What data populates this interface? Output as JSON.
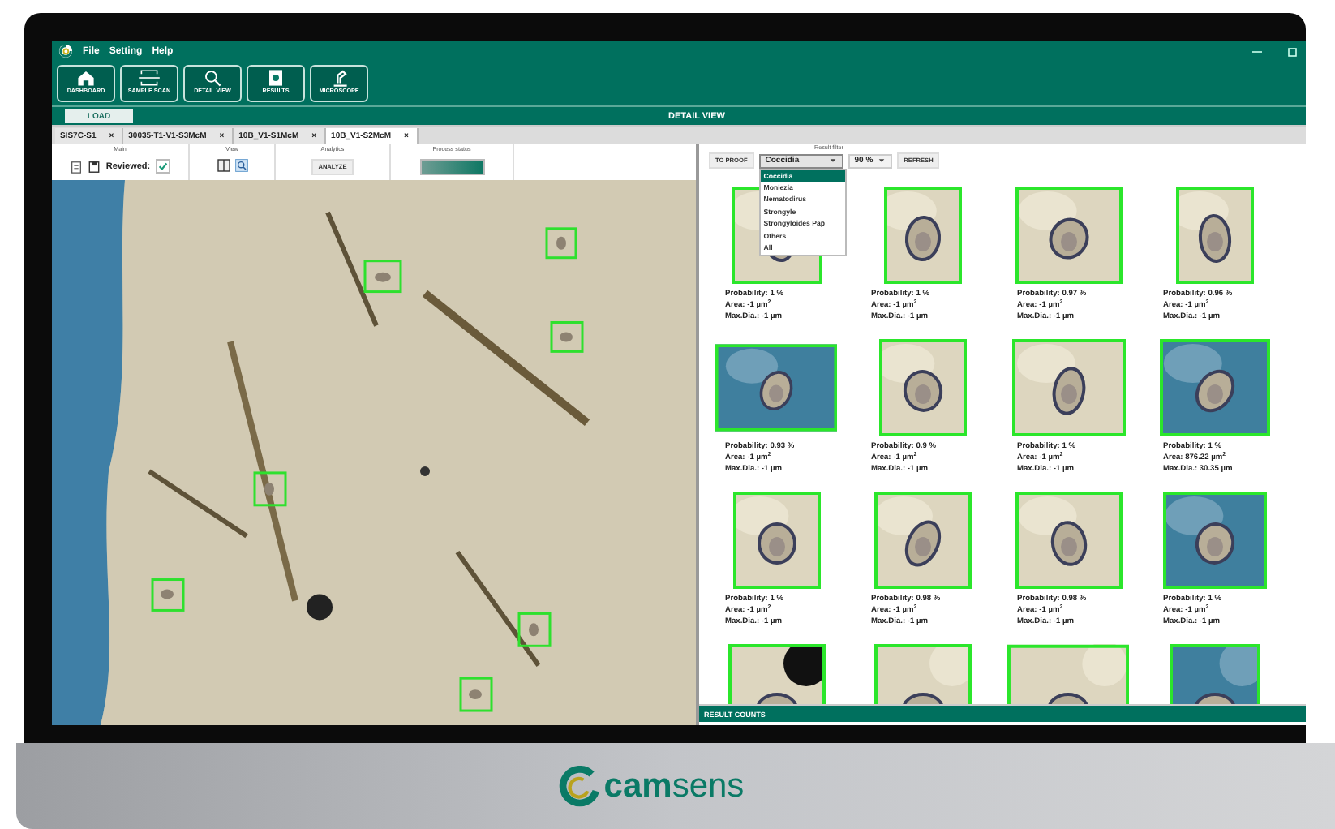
{
  "menu": [
    "File",
    "Setting",
    "Help"
  ],
  "toolbar": [
    {
      "label": "DASHBOARD",
      "kind": "home"
    },
    {
      "label": "SAMPLE SCAN",
      "kind": "scan"
    },
    {
      "label": "DETAIL VIEW",
      "kind": "search"
    },
    {
      "label": "RESULTS",
      "kind": "results"
    },
    {
      "label": "MICROSCOPE",
      "kind": "microscope"
    }
  ],
  "load_button": "LOAD",
  "view_title": "DETAIL VIEW",
  "tabs": [
    {
      "label": "SIS7C-S1",
      "close": "×",
      "selected": false
    },
    {
      "label": "30035-T1-V1-S3McM",
      "close": "×",
      "selected": false
    },
    {
      "label": "10B_V1-S1McM",
      "close": "×",
      "selected": false
    },
    {
      "label": "10B_V1-S2McM",
      "close": "×",
      "selected": true
    }
  ],
  "ribbon": {
    "main_title": "Main",
    "reviewed_label": "Reviewed:",
    "reviewed": true,
    "view_title": "View",
    "analytics_title": "Analytics",
    "analyze_button": "ANALYZE",
    "process_title": "Process status"
  },
  "filter": {
    "title": "Result filter",
    "proof_button": "TO PROOF",
    "class_value": "Coccidia",
    "expanded": true,
    "options": [
      {
        "label": "Coccidia",
        "selected": true
      },
      {
        "label": "Moniezia",
        "selected": false
      },
      {
        "label": "Nematodirus",
        "selected": false
      },
      {
        "label": "Strongyle",
        "selected": false
      },
      {
        "label": "Strongyloides Pap",
        "selected": false
      },
      {
        "label": "Others",
        "selected": false
      },
      {
        "label": "All",
        "selected": false
      }
    ],
    "threshold": "90 %",
    "refresh_button": "REFRESH"
  },
  "results": [
    {
      "probability": "Probability: 1 %",
      "area": "Area: -1 µm$^{2}$",
      "max_dia": "Max.Dia.: -1 µm"
    },
    {
      "probability": "Probability: 1 %",
      "area": "Area: -1 µm$^{2}$",
      "max_dia": "Max.Dia.: -1 µm"
    },
    {
      "probability": "Probability: 0.97 %",
      "area": "Area: -1 µm$^{2}$",
      "max_dia": "Max.Dia.: -1 µm"
    },
    {
      "probability": "Probability: 0.96 %",
      "area": "Area: -1 µm$^{2}$",
      "max_dia": "Max.Dia.: -1 µm"
    },
    {
      "probability": "Probability: 0.93 %",
      "area": "Area: -1 µm$^{2}$",
      "max_dia": "Max.Dia.: -1 µm"
    },
    {
      "probability": "Probability: 0.9 %",
      "area": "Area: -1 µm$^{2}$",
      "max_dia": "Max.Dia.: -1 µm"
    },
    {
      "probability": "Probability: 1 %",
      "area": "Area: -1 µm$^{2}$",
      "max_dia": "Max.Dia.: -1 µm"
    },
    {
      "probability": "Probability: 1 %",
      "area": "Area: 876.22 µm$^{2}$",
      "max_dia": "Max.Dia.: 30.35 µm"
    },
    {
      "probability": "Probability: 1 %",
      "area": "Area: -1 µm$^{2}$",
      "max_dia": "Max.Dia.: -1 µm"
    },
    {
      "probability": "Probability: 0.98 %",
      "area": "Area: -1 µm$^{2}$",
      "max_dia": "Max.Dia.: -1 µm"
    },
    {
      "probability": "Probability: 0.98 %",
      "area": "Area: -1 µm$^{2}$",
      "max_dia": "Max.Dia.: -1 µm"
    },
    {
      "probability": "Probability: 1 %",
      "area": "Area: -1 µm$^{2}$",
      "max_dia": "Max.Dia.: -1 µm"
    }
  ],
  "partial_results": [
    {
      "kind": "picture"
    },
    {
      "kind": "picture"
    },
    {
      "kind": "picture"
    },
    {
      "kind": "picture"
    }
  ],
  "result_counts": "RESULT COUNTS",
  "brand": "**cam**sens"
}
